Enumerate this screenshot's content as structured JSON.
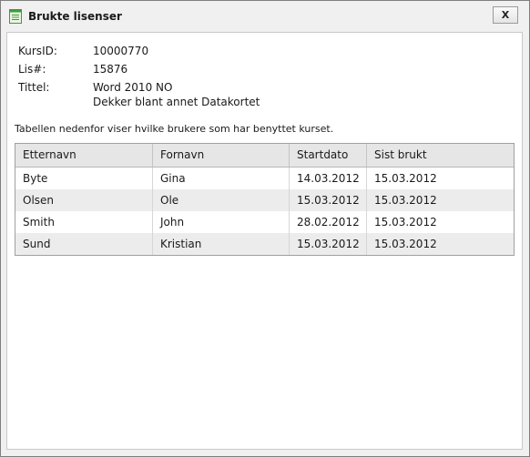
{
  "window": {
    "title": "Brukte lisenser",
    "close_label": "X"
  },
  "info": {
    "kursid_label": "KursID:",
    "kursid_value": "10000770",
    "lis_label": "Lis#:",
    "lis_value": "15876",
    "tittel_label": "Tittel:",
    "tittel_line1": "Word 2010 NO",
    "tittel_line2": "Dekker blant annet Datakortet"
  },
  "description": "Tabellen nedenfor viser hvilke brukere som har benyttet kurset.",
  "table": {
    "columns": [
      "Etternavn",
      "Fornavn",
      "Startdato",
      "Sist brukt"
    ],
    "rows": [
      [
        "Byte",
        "Gina",
        "14.03.2012",
        "15.03.2012"
      ],
      [
        "Olsen",
        "Ole",
        "15.03.2012",
        "15.03.2012"
      ],
      [
        "Smith",
        "John",
        "28.02.2012",
        "15.03.2012"
      ],
      [
        "Sund",
        "Kristian",
        "15.03.2012",
        "15.03.2012"
      ]
    ]
  },
  "icons": {
    "title_icon": "list-window-icon",
    "accent": "#3f9a3f"
  }
}
